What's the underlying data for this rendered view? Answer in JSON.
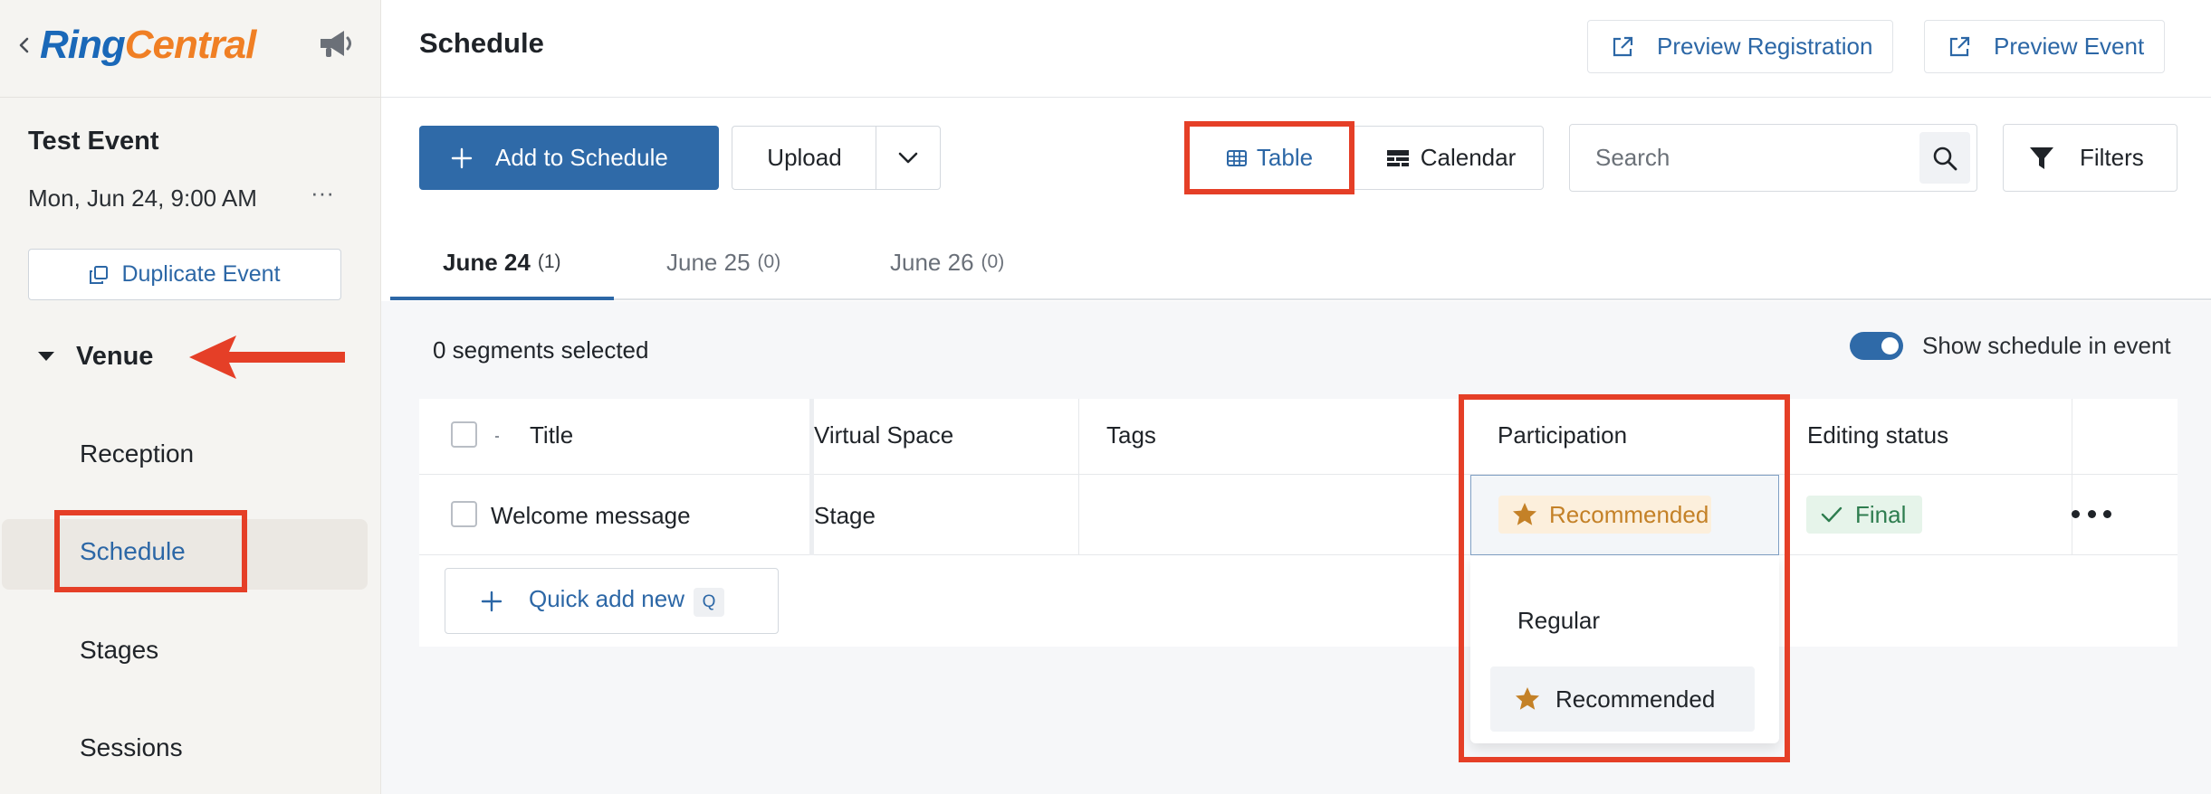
{
  "brand": {
    "logo_part1": "Ring",
    "logo_part2": "Central"
  },
  "event": {
    "name": "Test Event",
    "date": "Mon, Jun 24, 9:00 AM",
    "more": "···",
    "duplicate_label": "Duplicate Event"
  },
  "sidebar": {
    "section_label": "Venue",
    "items": [
      {
        "label": "Reception"
      },
      {
        "label": "Schedule"
      },
      {
        "label": "Stages"
      },
      {
        "label": "Sessions"
      }
    ]
  },
  "header": {
    "title": "Schedule",
    "preview_registration": "Preview Registration",
    "preview_event": "Preview Event"
  },
  "toolbar": {
    "add_label": "Add to Schedule",
    "upload_label": "Upload",
    "view_table": "Table",
    "view_calendar": "Calendar",
    "search_placeholder": "Search",
    "filters_label": "Filters"
  },
  "tabs": [
    {
      "label": "June 24",
      "count": "(1)"
    },
    {
      "label": "June 25",
      "count": "(0)"
    },
    {
      "label": "June 26",
      "count": "(0)"
    }
  ],
  "content": {
    "selected_text": "0 segments selected",
    "show_schedule_label": "Show schedule in event",
    "show_schedule_on": true
  },
  "table": {
    "headers": {
      "title": "Title",
      "space": "Virtual Space",
      "tags": "Tags",
      "participation": "Participation",
      "editing": "Editing status"
    },
    "rows": [
      {
        "title": "Welcome message",
        "space": "Stage",
        "tags": "",
        "participation": "Recommended",
        "editing": "Final"
      }
    ],
    "quick_add_label": "Quick add new",
    "quick_add_shortcut": "Q"
  },
  "participation_dropdown": {
    "options": [
      {
        "label": "Regular"
      },
      {
        "label": "Recommended"
      }
    ]
  },
  "colors": {
    "accent": "#2f6aa8",
    "annotation_red": "#e53f27",
    "recommended": "#c48127",
    "final": "#2e7d4f"
  }
}
